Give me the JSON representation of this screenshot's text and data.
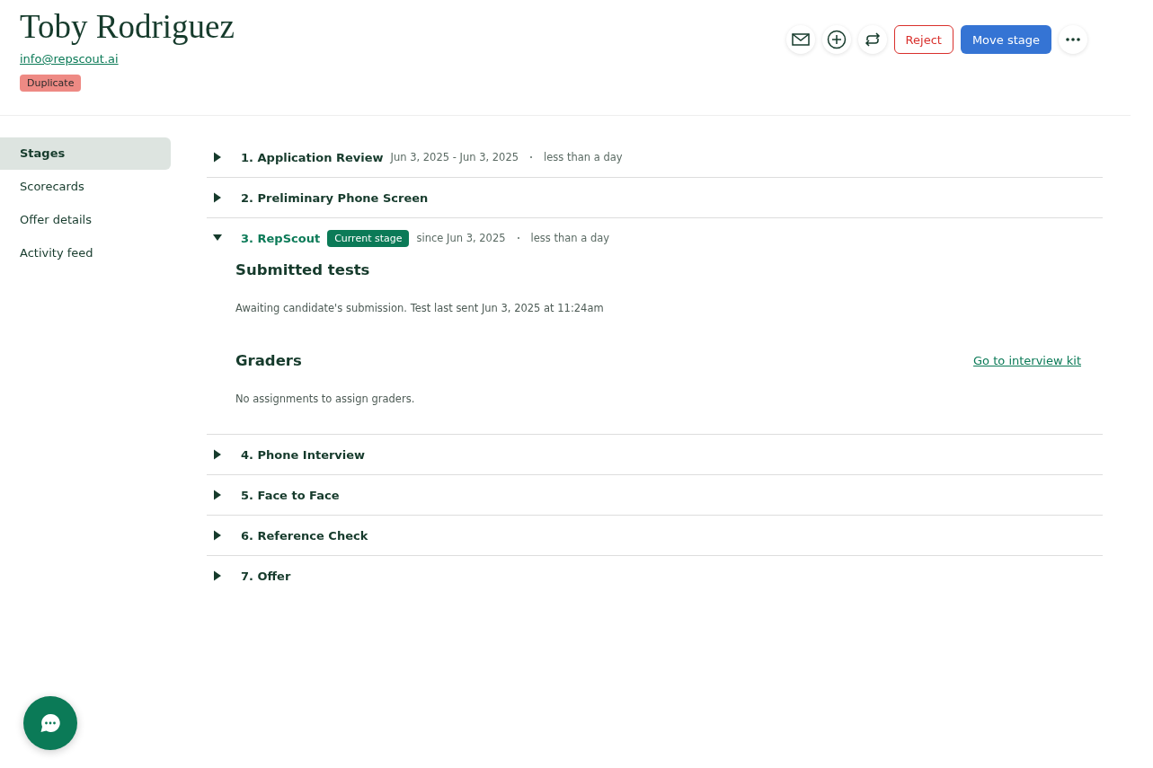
{
  "candidate": {
    "name": "Toby Rodriguez",
    "email": "info@repscout.ai",
    "tag": "Duplicate"
  },
  "actions": {
    "reject": "Reject",
    "move_stage": "Move stage"
  },
  "sidebar": {
    "items": [
      {
        "label": "Stages",
        "selected": true
      },
      {
        "label": "Scorecards",
        "selected": false
      },
      {
        "label": "Offer details",
        "selected": false
      },
      {
        "label": "Activity feed",
        "selected": false
      }
    ]
  },
  "stages": [
    {
      "title": "1. Application Review",
      "dates": "Jun 3, 2025 - Jun 3, 2025",
      "duration": "less than a day",
      "expanded": false,
      "current": false
    },
    {
      "title": "2. Preliminary Phone Screen",
      "expanded": false,
      "current": false
    },
    {
      "title": "3. RepScout",
      "badge": "Current stage",
      "dates": "since Jun 3, 2025",
      "duration": "less than a day",
      "expanded": true,
      "current": true,
      "sections": [
        {
          "heading": "Submitted tests",
          "text": "Awaiting candidate's submission. Test last sent Jun 3, 2025 at 11:24am"
        },
        {
          "heading": "Graders",
          "link": "Go to interview kit",
          "text": "No assignments to assign graders."
        }
      ]
    },
    {
      "title": "4. Phone Interview",
      "expanded": false,
      "current": false
    },
    {
      "title": "5. Face to Face",
      "expanded": false,
      "current": false
    },
    {
      "title": "6. Reference Check",
      "expanded": false,
      "current": false
    },
    {
      "title": "7. Offer",
      "expanded": false,
      "current": false
    }
  ]
}
